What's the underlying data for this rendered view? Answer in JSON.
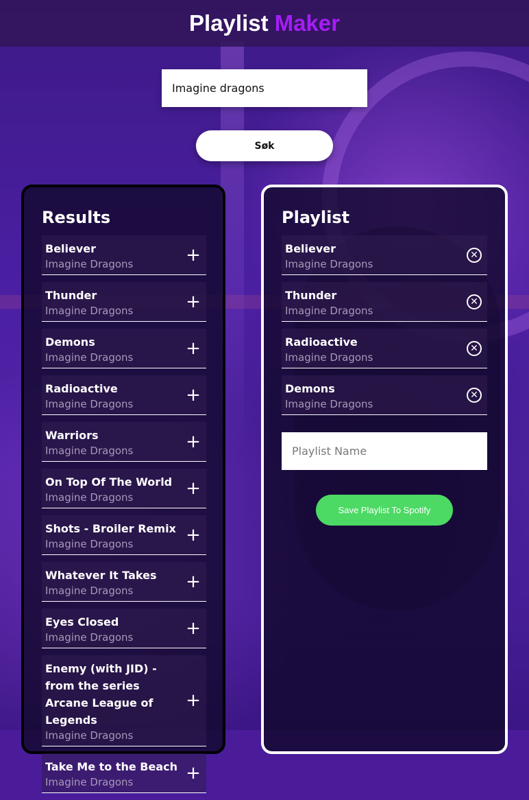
{
  "header": {
    "title_part1": "Playlist",
    "title_part2": "Maker"
  },
  "search": {
    "value": "Imagine dragons",
    "button_label": "Søk"
  },
  "results": {
    "title": "Results",
    "tracks": [
      {
        "title": "Believer",
        "artist": "Imagine Dragons"
      },
      {
        "title": "Thunder",
        "artist": "Imagine Dragons"
      },
      {
        "title": "Demons",
        "artist": "Imagine Dragons"
      },
      {
        "title": "Radioactive",
        "artist": "Imagine Dragons"
      },
      {
        "title": "Warriors",
        "artist": "Imagine Dragons"
      },
      {
        "title": "On Top Of The World",
        "artist": "Imagine Dragons"
      },
      {
        "title": "Shots - Broiler Remix",
        "artist": "Imagine Dragons"
      },
      {
        "title": "Whatever It Takes",
        "artist": "Imagine Dragons"
      },
      {
        "title": "Eyes Closed",
        "artist": "Imagine Dragons"
      },
      {
        "title": "Enemy (with JID) - from the series Arcane League of Legends",
        "artist": "Imagine Dragons"
      },
      {
        "title": "Take Me to the Beach",
        "artist": "Imagine Dragons"
      }
    ],
    "add_icon": "plus-icon"
  },
  "playlist": {
    "title": "Playlist",
    "tracks": [
      {
        "title": "Believer",
        "artist": "Imagine Dragons"
      },
      {
        "title": "Thunder",
        "artist": "Imagine Dragons"
      },
      {
        "title": "Radioactive",
        "artist": "Imagine Dragons"
      },
      {
        "title": "Demons",
        "artist": "Imagine Dragons"
      }
    ],
    "remove_icon": "circle-x-icon",
    "name_placeholder": "Playlist Name",
    "save_label": "Save Playlist To Spotify"
  },
  "colors": {
    "accent": "#a51df5",
    "save_button": "#4cd964",
    "background": "#4a1c9a"
  }
}
